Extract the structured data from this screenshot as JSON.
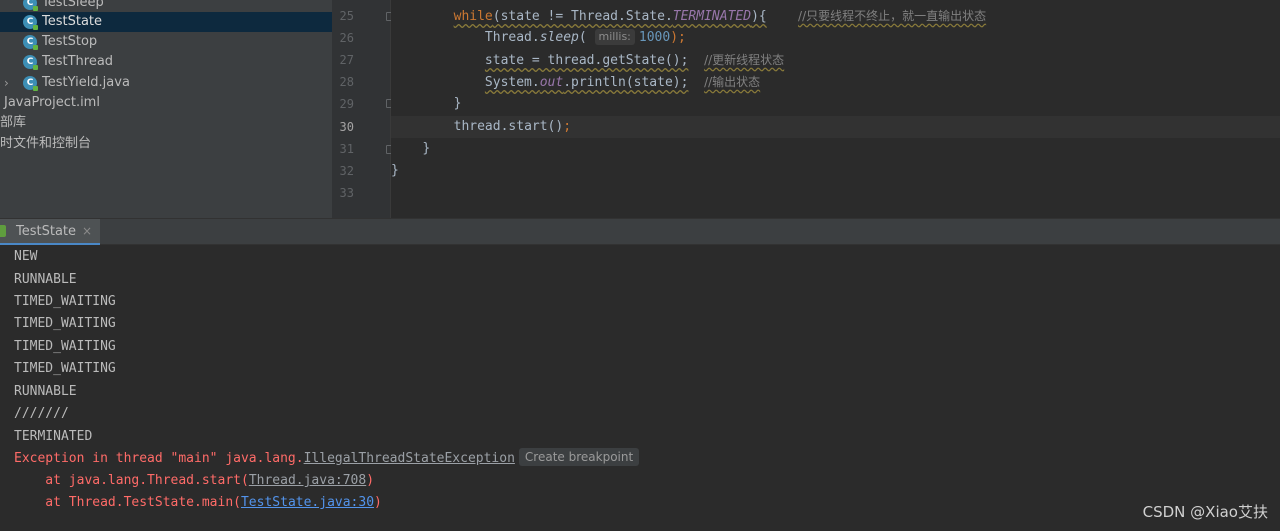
{
  "project_tree": {
    "items": [
      {
        "label": "TestSleep",
        "kind": "class",
        "selected": false
      },
      {
        "label": "TestState",
        "kind": "class",
        "selected": true
      },
      {
        "label": "TestStop",
        "kind": "class",
        "selected": false
      },
      {
        "label": "TestThread",
        "kind": "class",
        "selected": false
      },
      {
        "label": "TestYield.java",
        "kind": "class-collapsed",
        "selected": false
      },
      {
        "label": "JavaProject.iml",
        "kind": "file",
        "selected": false
      },
      {
        "label": "部库",
        "kind": "node",
        "selected": false
      },
      {
        "label": "时文件和控制台",
        "kind": "node",
        "selected": false
      }
    ],
    "class_icon_letter": "C"
  },
  "editor": {
    "line_numbers": [
      "25",
      "26",
      "27",
      "28",
      "29",
      "30",
      "31",
      "32",
      "33"
    ],
    "current_line": "30",
    "code": {
      "l25_kw": "while",
      "l25_a": "(state != Thread.State.",
      "l25_const": "TERMINATED",
      "l25_b": "){",
      "l25_cmt": "//只要线程不终止，就一直输出状态",
      "l26_a": "Thread.",
      "l26_method": "sleep",
      "l26_b": "( ",
      "l26_hint": "millis:",
      "l26_num": "1000",
      "l26_c": ");",
      "l27_a": "state = thread.getState();",
      "l27_cmt": "//更新线程状态",
      "l28_a": "System.",
      "l28_static": "out",
      "l28_b": ".println(state);",
      "l28_cmt": "//输出状态",
      "l29": "}",
      "l30_a": "thread.start()",
      "l30_semi": ";",
      "l31": "}",
      "l32": "}"
    }
  },
  "run_panel": {
    "tab_label": "TestState",
    "tab_close": "×",
    "output": [
      "NEW",
      "RUNNABLE",
      "TIMED_WAITING",
      "TIMED_WAITING",
      "TIMED_WAITING",
      "TIMED_WAITING",
      "RUNNABLE",
      "///////",
      "TERMINATED"
    ],
    "exception": {
      "prefix": "Exception in thread \"main\" java.lang.",
      "class_link": "IllegalThreadStateException",
      "breakpoint_button": "Create breakpoint",
      "frame1_prefix": "    at java.lang.Thread.start(",
      "frame1_link": "Thread.java:708",
      "frame1_suffix": ")",
      "frame2_prefix": "    at Thread.TestState.main(",
      "frame2_link": "TestState.java:30",
      "frame2_suffix": ")"
    }
  },
  "watermark": "CSDN @Xiao艾扶",
  "colors": {
    "keyword": "#cc7832",
    "constant": "#9876aa",
    "number": "#6897bb",
    "comment": "#808080",
    "error": "#ff6b68",
    "link": "#5394ec",
    "selection": "#0d293e"
  }
}
